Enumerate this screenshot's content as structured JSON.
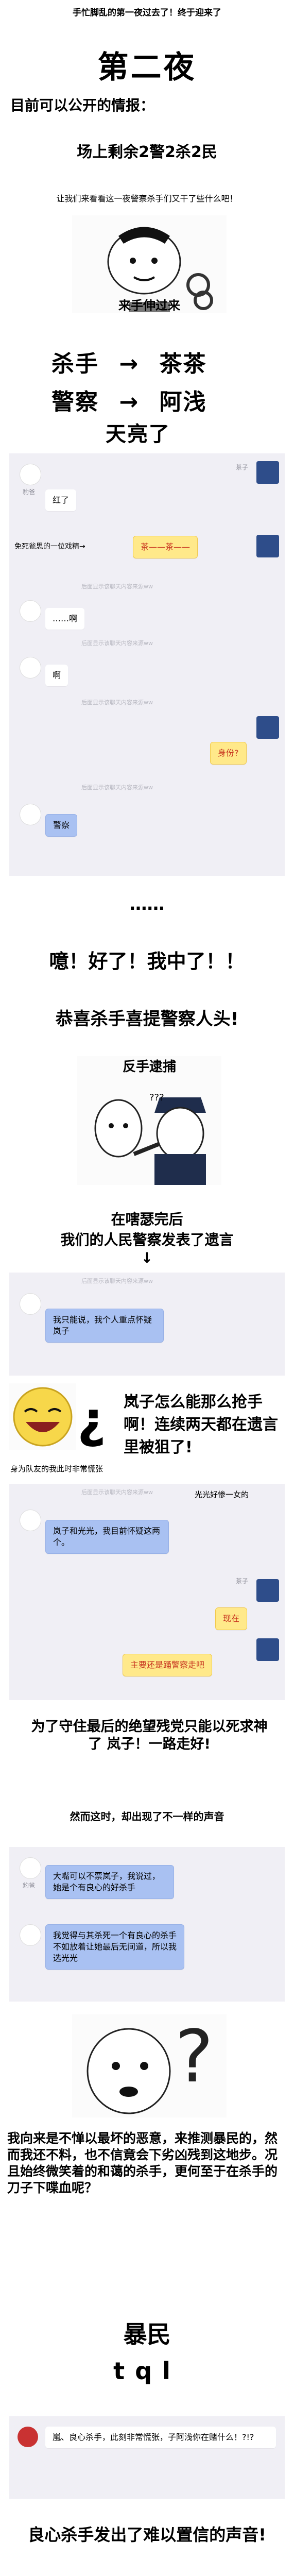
{
  "intro": "手忙脚乱的第一夜过去了！终于迎来了",
  "night_title": "第二夜",
  "info_title": "目前可以公开的情报：",
  "field_status": "场上剩余2警2杀2民",
  "question": "让我们来看看这一夜警察杀手们又干了些什么吧！",
  "meme1_caption": "来手伸过来",
  "pair1": {
    "role": "杀手",
    "arrow": "→",
    "name": "茶茶"
  },
  "pair2": {
    "role": "警察",
    "arrow": "→",
    "name": "阿浅"
  },
  "daybreak": "天亮了",
  "chat1": {
    "ts1": "后面显示该聊天内容来源ww",
    "left_name": "豹爸",
    "msg1": "红了",
    "right_name": "茶子",
    "msg2": "免死瓮思的一位戏精→",
    "msg2_b": "茶——茶——",
    "ts2": "后面显示该聊天内容来源ww",
    "msg3": "……啊",
    "ts3": "后面显示该聊天内容来源ww",
    "msg4": "啊",
    "ts4": "后面显示该聊天内容来源ww",
    "msg5": "身份?",
    "ts5": "后面显示该聊天内容来源ww",
    "msg6": "警察"
  },
  "dots": "……",
  "exclaim": "噫！好了！我中了！！",
  "congrats": "恭喜杀手喜提警察人头!",
  "meme2_caption": "反手逮捕",
  "meme2_q": "???",
  "after1": "在嗐瑟完后",
  "after2": "我们的人民警察发表了遗言",
  "after_arrow": "↓",
  "chat2": {
    "ts1": "后面显示该聊天内容来源ww",
    "msg1": "我只能说，我个人重点怀疑岚子"
  },
  "meme3_text": "岚子怎么能那么抢手啊！连续两天都在遗言里被狙了!",
  "meme3_caption": "身为队友的我此时非常慌张",
  "chat3": {
    "ts1": "后面显示该聊天内容来源ww",
    "right_text": "光光好惨一女的",
    "msg1": "岚子和光光，我目前怀疑这两个。",
    "right_name": "茶子",
    "msg2": "现在",
    "msg3": "主要还是踊警察走吧"
  },
  "vow": "为了守住最后的绝望残党只能以死求神了 岚子！一路走好!",
  "sound": "然而这时，却出现了不一样的声音",
  "chat4": {
    "left_name": "豹爸",
    "msg1": "大嘴可以不票岚子，我说过，她是个有良心的好杀手",
    "msg2": "我觉得与其杀死一个有良心的杀手不如放着让她最后无间道，所以我选光光"
  },
  "conclusion": "我向来是不惮以最坏的恶意，来推测暴民的，然而我还不料，也不信竟会下劣凶残到这地步。况且始终微笑着的和蔼的杀手，更何至于在杀手的刀子下喋血呢？",
  "mob": "暴民",
  "tql": "tql",
  "final_chat": "嵐、良心杀手，此刻非常慌张，子阿浅你在赌什么！?!?",
  "final": "良心杀手发出了难以置信的声音!"
}
